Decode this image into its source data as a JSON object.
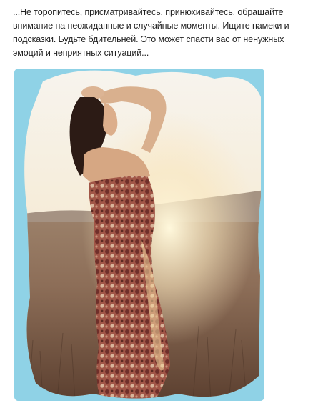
{
  "post": {
    "text": "...Не торопитесь, присматривайтесь, принюхивайтесь, обращайте внимание на неожиданные и случайные моменты. Ищите намеки и подсказки. Будьте бдительней. Это может спасти вас от ненужных эмоций и неприятных ситуаций..."
  },
  "colors": {
    "frame_background": "#8fd2e6",
    "sky": "#f3ecdc",
    "sun_glow": "#fff6d8",
    "dress": "#8a4a3e",
    "hair": "#2a1a14"
  },
  "image": {
    "icon": "photo-woman-in-field"
  }
}
